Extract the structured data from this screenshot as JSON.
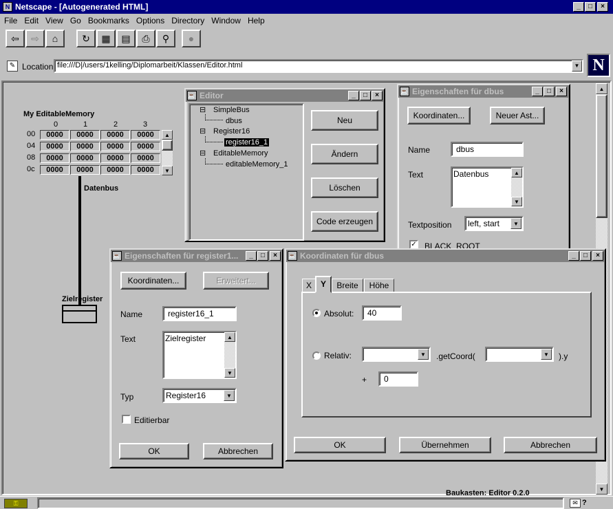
{
  "app": {
    "title": "Netscape - [Autogenerated HTML]"
  },
  "menu": [
    "File",
    "Edit",
    "View",
    "Go",
    "Bookmarks",
    "Options",
    "Directory",
    "Window",
    "Help"
  ],
  "location": {
    "label": "Location:",
    "url": "file:///D|/users/1kelling/Diplomarbeit/Klassen/Editor.html"
  },
  "canvas": {
    "memory_title": "My EditableMemory",
    "col_headers": [
      "0",
      "1",
      "2",
      "3"
    ],
    "rows": [
      {
        "addr": "00",
        "cells": [
          "0000",
          "0000",
          "0000",
          "0000"
        ]
      },
      {
        "addr": "04",
        "cells": [
          "0000",
          "0000",
          "0000",
          "0000"
        ]
      },
      {
        "addr": "08",
        "cells": [
          "0000",
          "0000",
          "0000",
          "0000"
        ]
      },
      {
        "addr": "0c",
        "cells": [
          "0000",
          "0000",
          "0000",
          "0000"
        ]
      }
    ],
    "bus_label": "Datenbus",
    "register_label": "Zielregister",
    "footer": "Baukasten: Editor 0.2.0"
  },
  "editor": {
    "title": "Editor",
    "tree": [
      {
        "text": "SimpleBus",
        "level": 0
      },
      {
        "text": "dbus",
        "level": 1
      },
      {
        "text": "Register16",
        "level": 0
      },
      {
        "text": "register16_1",
        "level": 1,
        "selected": true
      },
      {
        "text": "EditableMemory",
        "level": 0
      },
      {
        "text": "editableMemory_1",
        "level": 1
      }
    ],
    "btn_new": "Neu",
    "btn_change": "Ändern",
    "btn_delete": "Löschen",
    "btn_code": "Code erzeugen"
  },
  "props_dbus": {
    "title": "Eigenschaften für dbus",
    "btn_coords": "Koordinaten...",
    "btn_new_branch": "Neuer Ast...",
    "name_label": "Name",
    "name_value": "dbus",
    "text_label": "Text",
    "text_value": "Datenbus",
    "textpos_label": "Textposition",
    "textpos_value": "left, start",
    "checkbox_label": "BLACK_ROOT"
  },
  "props_reg": {
    "title": "Eigenschaften für register1...",
    "btn_coords": "Koordinaten...",
    "btn_extended": "Erweitert...",
    "name_label": "Name",
    "name_value": "register16_1",
    "text_label": "Text",
    "text_value": "Zielregister",
    "type_label": "Typ",
    "type_value": "Register16",
    "editable_label": "Editierbar",
    "ok": "OK",
    "cancel": "Abbrechen"
  },
  "coords": {
    "title": "Koordinaten für dbus",
    "tabs": [
      "X",
      "Y",
      "Breite",
      "Höhe"
    ],
    "active_tab": "Y",
    "absolute_label": "Absolut:",
    "absolute_value": "40",
    "relative_label": "Relativ:",
    "getcoord_label": ".getCoord(",
    "suffix_label": ").y",
    "plus_label": "+",
    "offset_value": "0",
    "ok": "OK",
    "apply": "Übernehmen",
    "cancel": "Abbrechen"
  }
}
